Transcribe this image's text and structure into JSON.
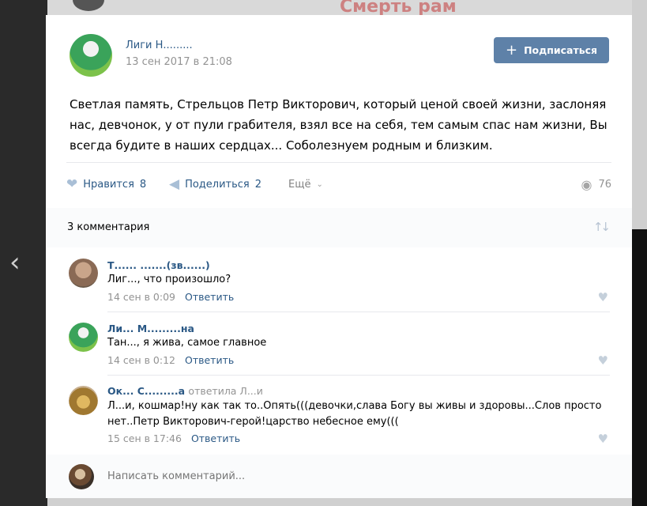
{
  "background": {
    "partial_title": "Смерть рам"
  },
  "nav": {
    "prev_glyph": "‹"
  },
  "post": {
    "author": "Лиги Н.........",
    "date": "13 сен 2017 в 21:08",
    "subscribe_label": "Подписаться",
    "text": "Светлая память, Стрельцов Петр Викторович, который ценой своей жизни, заслоняя нас, девчонок, у от пули грабителя, взял все на себя, тем самым спас нам жизни, Вы всегда будите в наших сердцах... Соболезнуем родным и близким.",
    "likes_label": "Нравится",
    "likes_count": "8",
    "share_label": "Поделиться",
    "share_count": "2",
    "more_label": "Ещё",
    "views_count": "76"
  },
  "comments": {
    "count_label": "3 комментария",
    "items": [
      {
        "name": "Т......  .......(зв......)",
        "text": "Лиг..., что произошло?",
        "date": "14 сен в 0:09",
        "reply_label": "Ответить"
      },
      {
        "name": "Ли...  М.........на",
        "text": "Тан..., я жива, самое главное",
        "date": "14 сен в 0:12",
        "reply_label": "Ответить"
      },
      {
        "name": "Ок...  С.........а",
        "reply_to": "ответила Л...и",
        "text": "Л...и, кошмар!ну как так то..Опять(((девочки,слава Богу вы живы и здоровы...Слов просто нет..Петр Викторович-герой!царство небесное ему(((",
        "date": "15 сен в 17:46",
        "reply_label": "Ответить"
      }
    ]
  },
  "write_comment": {
    "placeholder": "Написать комментарий..."
  },
  "colors": {
    "link": "#2a5885",
    "button": "#5e81a8",
    "muted": "#939393"
  },
  "icons": {
    "like": "heart-icon",
    "share": "megaphone-icon",
    "more": "chevron-down-icon",
    "views": "eye-icon",
    "sort": "sort-arrows-icon",
    "subscribe": "plus-icon"
  }
}
